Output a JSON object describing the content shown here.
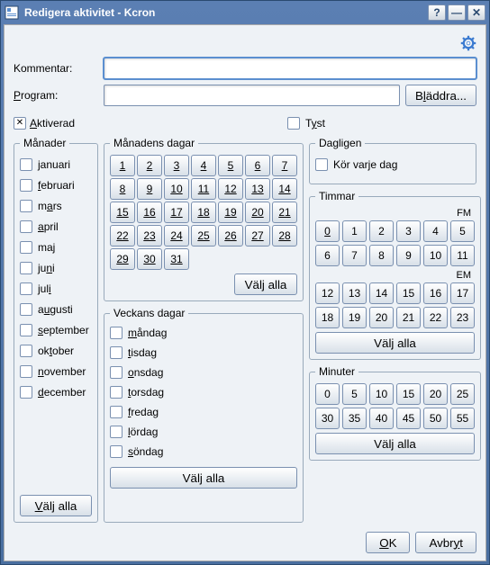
{
  "window": {
    "title": "Redigera aktivitet - Kcron"
  },
  "labels": {
    "comment": "Kommentar:",
    "program": "Program:",
    "browse": "Bläddra...",
    "activated": "Aktiverad",
    "silent": "Tyst",
    "months_legend": "Månader",
    "monthdays_legend": "Månadens dagar",
    "weekdays_legend": "Veckans dagar",
    "daily_legend": "Dagligen",
    "daily_check": "Kör varje dag",
    "hours_legend": "Timmar",
    "minutes_legend": "Minuter",
    "fm": "FM",
    "em": "EM",
    "select_all": "Välj alla",
    "ok": "OK",
    "cancel": "Avbryt"
  },
  "inputs": {
    "comment": "",
    "program": ""
  },
  "checks": {
    "activated": true,
    "silent": false,
    "daily": false
  },
  "months": [
    "januari",
    "februari",
    "mars",
    "april",
    "maj",
    "juni",
    "juli",
    "augusti",
    "september",
    "oktober",
    "november",
    "december"
  ],
  "month_underline_idx": [
    0,
    0,
    1,
    0,
    2,
    2,
    3,
    1,
    0,
    2,
    0,
    0
  ],
  "weekdays": [
    "måndag",
    "tisdag",
    "onsdag",
    "torsdag",
    "fredag",
    "lördag",
    "söndag"
  ],
  "monthdays": 31,
  "hours_fm": [
    0,
    1,
    2,
    3,
    4,
    5,
    6,
    7,
    8,
    9,
    10,
    11
  ],
  "hours_em": [
    12,
    13,
    14,
    15,
    16,
    17,
    18,
    19,
    20,
    21,
    22,
    23
  ],
  "minutes": [
    0,
    5,
    10,
    15,
    20,
    25,
    30,
    35,
    40,
    45,
    50,
    55
  ]
}
